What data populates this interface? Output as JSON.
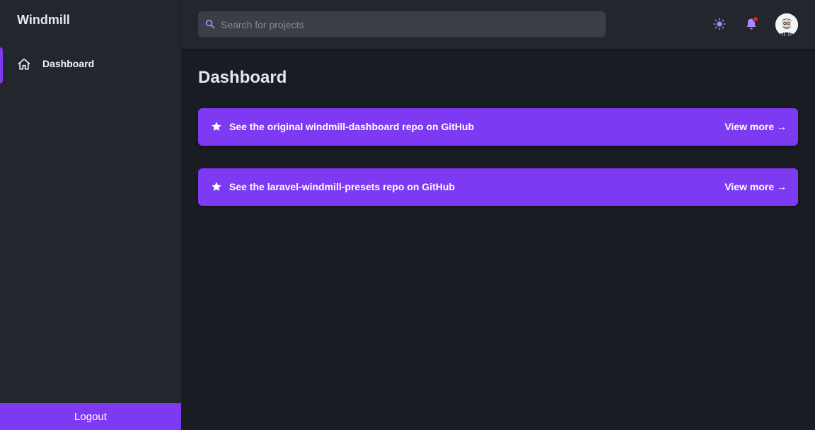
{
  "sidebar": {
    "brand": "Windmill",
    "items": [
      {
        "label": "Dashboard",
        "icon": "home-icon",
        "active": true
      }
    ],
    "logout_label": "Logout"
  },
  "header": {
    "search": {
      "placeholder": "Search for projects",
      "value": ""
    },
    "icons": [
      "search-icon",
      "sun-icon",
      "bell-icon",
      "avatar"
    ],
    "notification_dot_color": "#e02424"
  },
  "main": {
    "title": "Dashboard",
    "banners": [
      {
        "text": "See the original windmill-dashboard repo on GitHub",
        "link_label": "View more →",
        "icon": "star-icon"
      },
      {
        "text": "See the laravel-windmill-presets repo on GitHub",
        "link_label": "View more →",
        "icon": "star-icon"
      }
    ]
  },
  "colors": {
    "accent": "#7e3af2",
    "background": "#1a1c23",
    "surface": "#24262d",
    "search_bg": "#393e47",
    "icon_accent": "#a78bfa"
  }
}
